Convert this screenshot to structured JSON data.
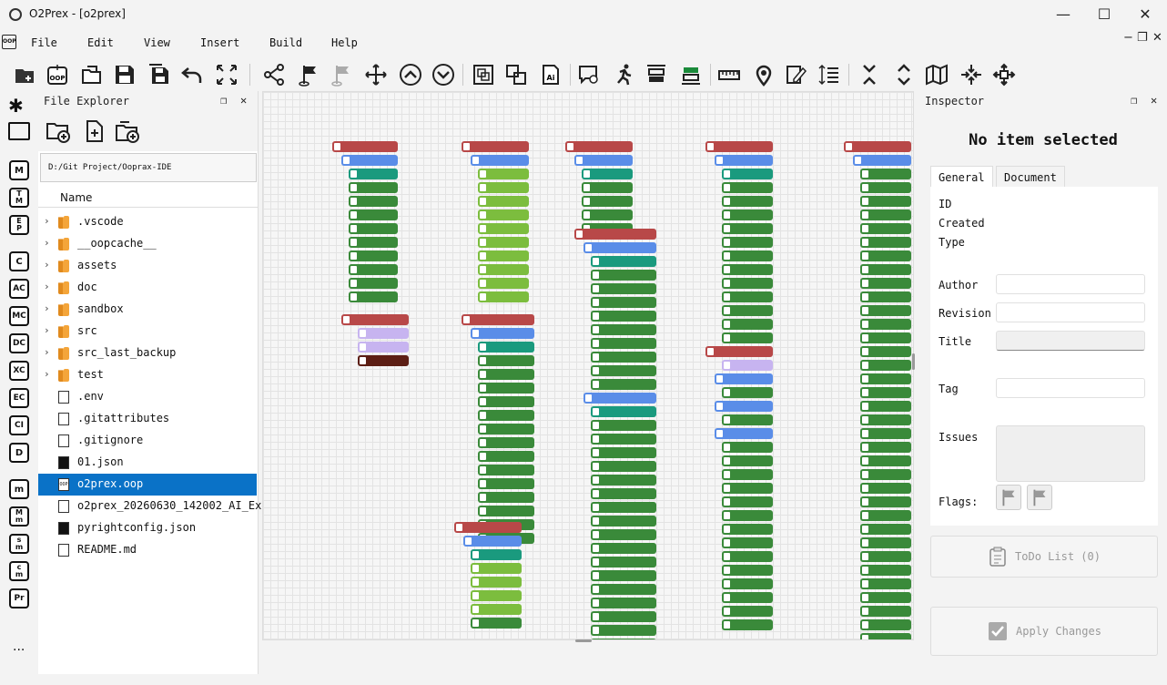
{
  "window": {
    "title": "O2Prex - [o2prex]",
    "controls": {
      "minimize": "—",
      "maximize": "☐",
      "close": "✕"
    }
  },
  "menu": {
    "items": [
      "File",
      "Edit",
      "View",
      "Insert",
      "Build",
      "Help"
    ],
    "mdi_controls": {
      "minimize": "−",
      "restore": "❐",
      "close": "✕"
    }
  },
  "toolbar": {
    "icons": [
      "new-file-icon",
      "new-oop-icon",
      "open-folder-icon",
      "save-icon",
      "save-all-icon",
      "undo-icon",
      "fit-icon",
      "share-icon",
      "flag-icon",
      "flag-disabled-icon",
      "move-icon",
      "up-circle-icon",
      "down-circle-icon",
      "group-icon",
      "ungroup-icon",
      "ai-icon",
      "comment-icon",
      "run-icon",
      "align-top-icon",
      "align-bottom-icon",
      "ruler-icon",
      "pin-icon",
      "edit-icon",
      "line-height-icon",
      "collapse-icon",
      "expand-icon",
      "map-icon",
      "compress-icon",
      "expand-all-icon"
    ]
  },
  "rail": {
    "buttons": [
      "M",
      "T\nM",
      "E\nP",
      "C",
      "AC",
      "MC",
      "DC",
      "XC",
      "EC",
      "CI",
      "D",
      "m",
      "M\nm",
      "s\nm",
      "c\nm",
      "Pr"
    ],
    "more": "..."
  },
  "explorer": {
    "title": "File Explorer",
    "path": "D:/Git Project/Ooprax-IDE",
    "column": "Name",
    "items": [
      {
        "name": ".vscode",
        "type": "folder"
      },
      {
        "name": "__oopcache__",
        "type": "folder"
      },
      {
        "name": "assets",
        "type": "folder"
      },
      {
        "name": "doc",
        "type": "folder"
      },
      {
        "name": "sandbox",
        "type": "folder"
      },
      {
        "name": "src",
        "type": "folder"
      },
      {
        "name": "src_last_backup",
        "type": "folder"
      },
      {
        "name": "test",
        "type": "folder"
      },
      {
        "name": ".env",
        "type": "file"
      },
      {
        "name": ".gitattributes",
        "type": "file"
      },
      {
        "name": ".gitignore",
        "type": "file"
      },
      {
        "name": "01.json",
        "type": "json"
      },
      {
        "name": "o2prex.oop",
        "type": "oop",
        "selected": true
      },
      {
        "name": "o2prex_20260630_142002_AI_Ex",
        "type": "file"
      },
      {
        "name": "pyrightconfig.json",
        "type": "json"
      },
      {
        "name": "README.md",
        "type": "file"
      }
    ]
  },
  "inspector": {
    "title": "Inspector",
    "heading": "No item selected",
    "tabs": [
      "General",
      "Document"
    ],
    "fields": {
      "id": "ID",
      "created": "Created",
      "type": "Type",
      "author": "Author",
      "revision": "Revision",
      "title": "Title",
      "tag": "Tag",
      "issues": "Issues",
      "flags": "Flags:"
    },
    "todo_button": "ToDo List (0)",
    "apply_button": "Apply Changes"
  }
}
